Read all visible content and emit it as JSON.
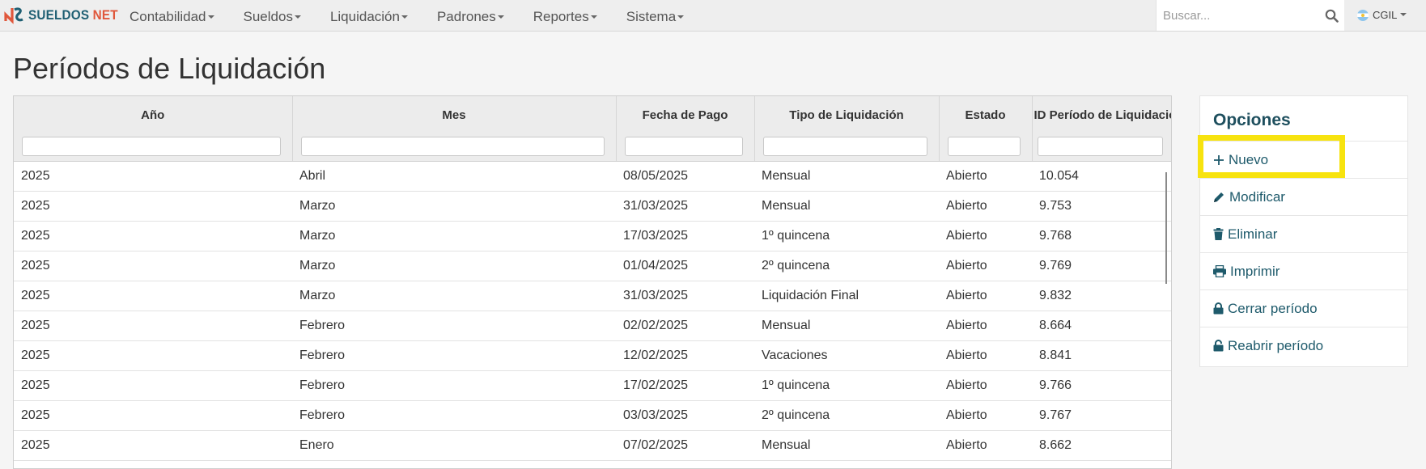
{
  "brand": {
    "part1": "SUELDOS ",
    "part2": "NET"
  },
  "menu": [
    {
      "label": "Contabilidad"
    },
    {
      "label": "Sueldos"
    },
    {
      "label": "Liquidación"
    },
    {
      "label": "Padrones"
    },
    {
      "label": "Reportes"
    },
    {
      "label": "Sistema"
    }
  ],
  "search": {
    "placeholder": "Buscar...",
    "value": ""
  },
  "user": {
    "label": "CGIL"
  },
  "page": {
    "title": "Períodos de Liquidación"
  },
  "table": {
    "columns": [
      "Año",
      "Mes",
      "Fecha de Pago",
      "Tipo de Liquidación",
      "Estado",
      "ID Período de Liquidación"
    ],
    "rows": [
      [
        "2025",
        "Abril",
        "08/05/2025",
        "Mensual",
        "Abierto",
        "10.054"
      ],
      [
        "2025",
        "Marzo",
        "31/03/2025",
        "Mensual",
        "Abierto",
        "9.753"
      ],
      [
        "2025",
        "Marzo",
        "17/03/2025",
        "1º quincena",
        "Abierto",
        "9.768"
      ],
      [
        "2025",
        "Marzo",
        "01/04/2025",
        "2º quincena",
        "Abierto",
        "9.769"
      ],
      [
        "2025",
        "Marzo",
        "31/03/2025",
        "Liquidación Final",
        "Abierto",
        "9.832"
      ],
      [
        "2025",
        "Febrero",
        "02/02/2025",
        "Mensual",
        "Abierto",
        "8.664"
      ],
      [
        "2025",
        "Febrero",
        "12/02/2025",
        "Vacaciones",
        "Abierto",
        "8.841"
      ],
      [
        "2025",
        "Febrero",
        "17/02/2025",
        "1º quincena",
        "Abierto",
        "9.766"
      ],
      [
        "2025",
        "Febrero",
        "03/03/2025",
        "2º quincena",
        "Abierto",
        "9.767"
      ],
      [
        "2025",
        "Enero",
        "07/02/2025",
        "Mensual",
        "Abierto",
        "8.662"
      ]
    ]
  },
  "options": {
    "title": "Opciones",
    "items": [
      {
        "label": "Nuevo",
        "icon": "plus-icon"
      },
      {
        "label": "Modificar",
        "icon": "pencil-icon"
      },
      {
        "label": "Eliminar",
        "icon": "trash-icon"
      },
      {
        "label": "Imprimir",
        "icon": "print-icon"
      },
      {
        "label": "Cerrar período",
        "icon": "lock-icon"
      },
      {
        "label": "Reabrir período",
        "icon": "unlock-icon"
      }
    ]
  },
  "colors": {
    "accent": "#1e5a6b",
    "highlight": "#f7e30f",
    "brand_teal": "#1f5f73",
    "brand_orange": "#e0573b"
  }
}
